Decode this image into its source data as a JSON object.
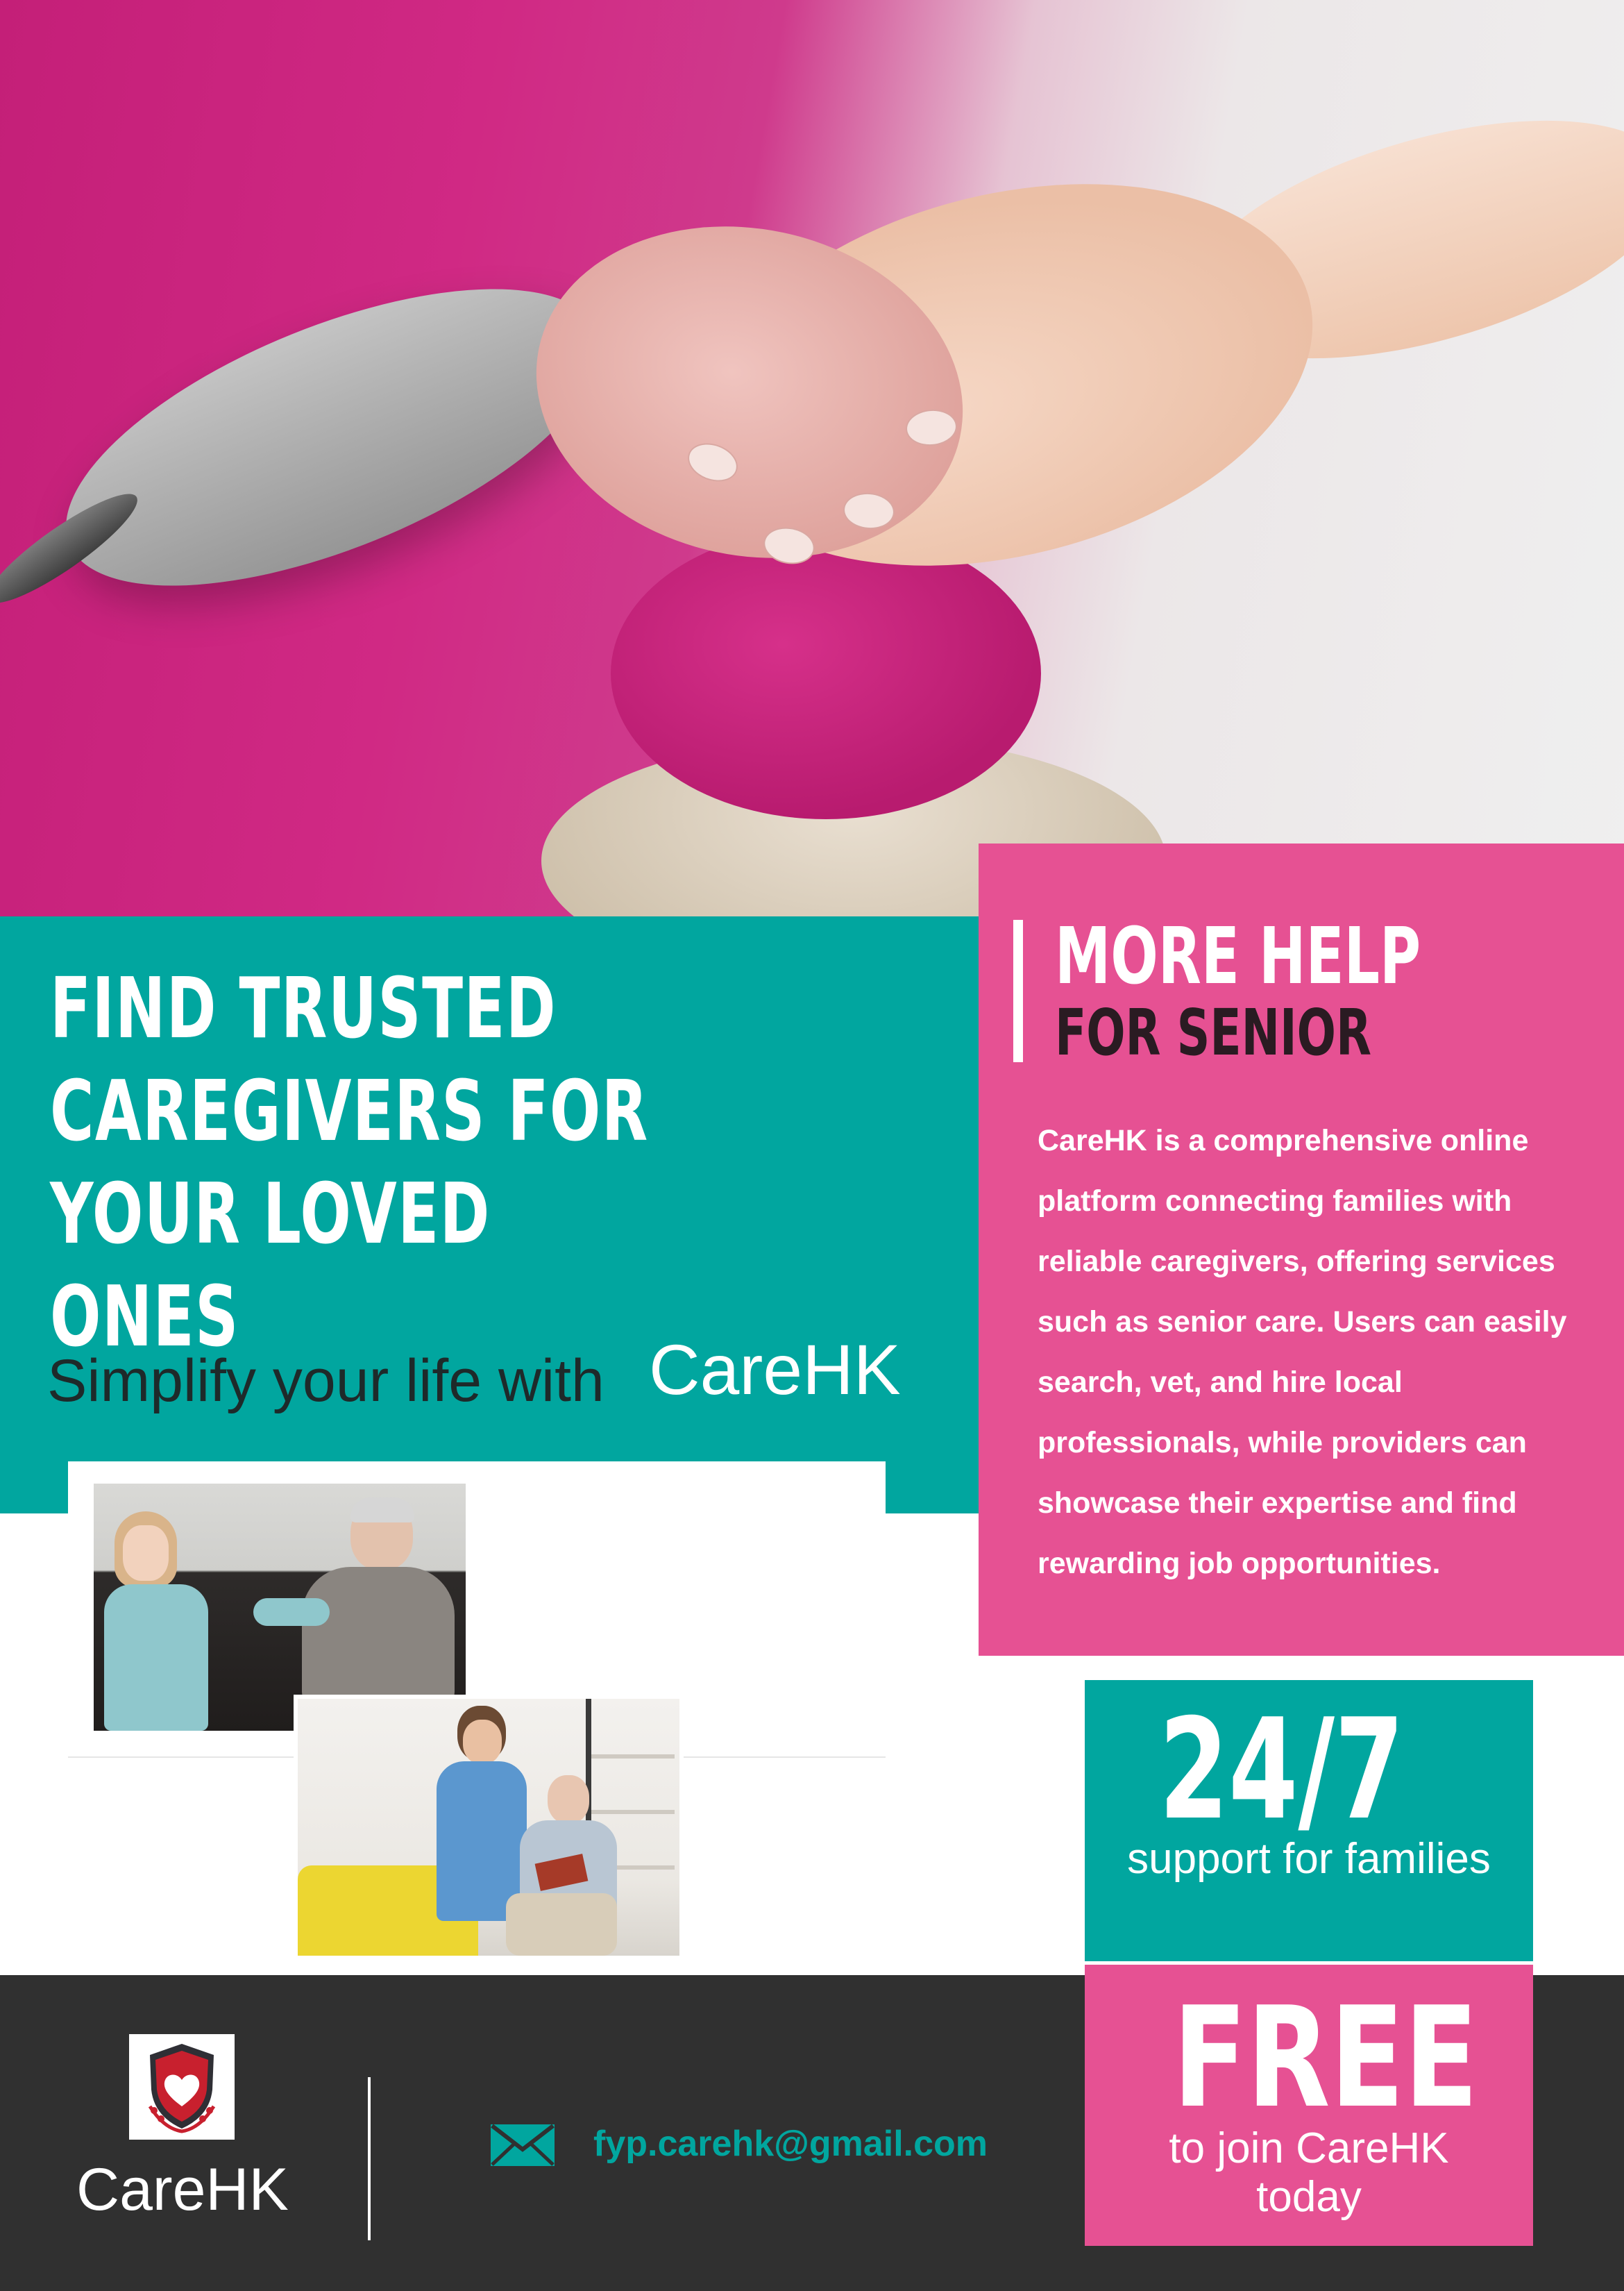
{
  "headline": {
    "line1": "FIND TRUSTED",
    "line2": "CAREGIVERS FOR",
    "line3": "YOUR LOVED ONES"
  },
  "tagline": {
    "text": "Simplify your life with",
    "brand": "CareHK"
  },
  "help_section": {
    "title": "MORE HELP",
    "subtitle": "FOR SENIOR",
    "description": "CareHK is a comprehensive online platform connecting families with reliable caregivers, offering services such as senior care. Users can easily search, vet, and hire local professionals, while providers can showcase their expertise and find rewarding job opportunities."
  },
  "stats": {
    "support": {
      "value": "24/7",
      "label": "support for families"
    },
    "free": {
      "value": "FREE",
      "label_line1": "to join CareHK",
      "label_line2": "today"
    }
  },
  "footer": {
    "brand": "CareHK",
    "email": "fyp.carehk@gmail.com",
    "logo_icon": "shield-heart-laurel-icon",
    "email_icon": "envelope-icon"
  },
  "colors": {
    "teal": "#01a69f",
    "pink": "#e65193",
    "dark": "#303030",
    "white": "#ffffff"
  }
}
